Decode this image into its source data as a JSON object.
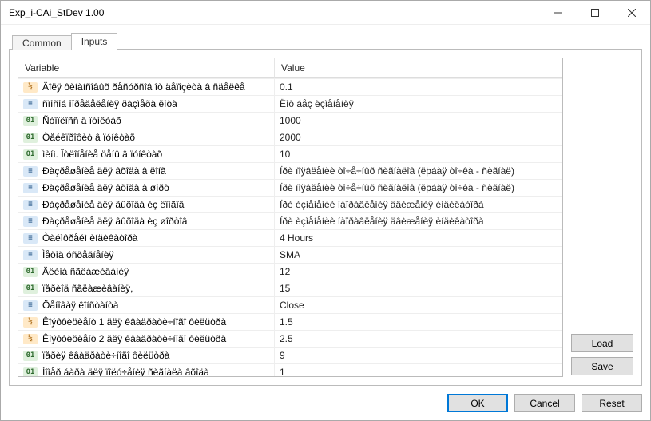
{
  "window": {
    "title": "Exp_i-CAi_StDev 1.00"
  },
  "tabs": {
    "common": "Common",
    "inputs": "Inputs",
    "active": "inputs"
  },
  "table": {
    "headers": {
      "variable": "Variable",
      "value": "Value"
    },
    "rows": [
      {
        "type": "frac",
        "variable": "Äîëÿ ôèíàíñîâûõ ðåñóðñîâ îò äåïîçèòà â ñäåëêå",
        "value": "0.1"
      },
      {
        "type": "menu",
        "variable": "ñïîñîá îïðåäåëåíèÿ ðàçìåðà ëîòà",
        "value": "Ëîò áåç èçìåíåíèÿ"
      },
      {
        "type": "01",
        "variable": "Ñòîïëîññ â ïóíêòàõ",
        "value": "1000"
      },
      {
        "type": "01",
        "variable": "Òåéêïðîôèò â ïóíêòàõ",
        "value": "2000"
      },
      {
        "type": "01",
        "variable": "ìèíì. Îòëîíåíèå öåíû â ïóíêòàõ",
        "value": "10"
      },
      {
        "type": "menu",
        "variable": "Ðàçðåøåíèå äëÿ âõîäà â ëîíã",
        "value": "Ïðè ïîÿâëåíèè òî÷å÷íûõ ñèãíàëîâ (ëþáàÿ òî÷êà - ñèãíàë)"
      },
      {
        "type": "menu",
        "variable": "Ðàçðåøåíèå äëÿ âõîäà â øîðò",
        "value": "Ïðè ïîÿâëåíèè òî÷å÷íûõ ñèãíàëîâ (ëþáàÿ òî÷êà - ñèãíàë)"
      },
      {
        "type": "menu",
        "variable": "Ðàçðåøåíèå äëÿ âûõîäà èç ëîíãîâ",
        "value": "Ïðè èçìåíåíèè íàïðàâëåíèÿ äâèæåíèÿ èíäèêàòîðà"
      },
      {
        "type": "menu",
        "variable": "Ðàçðåøåíèå äëÿ âûõîäà èç øîðòîâ",
        "value": "Ïðè èçìåíåíèè íàïðàâëåíèÿ äâèæåíèÿ èíäèêàòîðà"
      },
      {
        "type": "menu",
        "variable": "Òàéìôðåéì èíäèêàòîðà",
        "value": "4 Hours"
      },
      {
        "type": "menu",
        "variable": "Ìåòîä óñðåäíåíèÿ",
        "value": "SMA"
      },
      {
        "type": "01",
        "variable": "Äëèíà ñãëàæèâàíèÿ",
        "value": "12"
      },
      {
        "type": "01",
        "variable": "ïåðèîä ñãëàæèâàíèÿ,",
        "value": "15"
      },
      {
        "type": "menu",
        "variable": "Öåíîâàÿ êîíñòàíòà",
        "value": "Close"
      },
      {
        "type": "frac",
        "variable": "Êîýôôèöèåíò 1 äëÿ êâàäðàòè÷íîãî ôèëüòðà",
        "value": "1.5"
      },
      {
        "type": "frac",
        "variable": "Êîýôôèöèåíò 2 äëÿ êâàäðàòè÷íîãî ôèëüòðà",
        "value": "2.5"
      },
      {
        "type": "01",
        "variable": "ïåðèÿ êâàäðàòè÷íîãî ôèëüòðà",
        "value": "9"
      },
      {
        "type": "01",
        "variable": "Íîìåð áàðà äëÿ ïîëó÷åíèÿ ñèãíàëà âõîäà",
        "value": "1"
      }
    ]
  },
  "buttons": {
    "load": "Load",
    "save": "Save",
    "ok": "OK",
    "cancel": "Cancel",
    "reset": "Reset"
  },
  "type_glyphs": {
    "frac": "½",
    "menu": "≡",
    "01": "01"
  }
}
